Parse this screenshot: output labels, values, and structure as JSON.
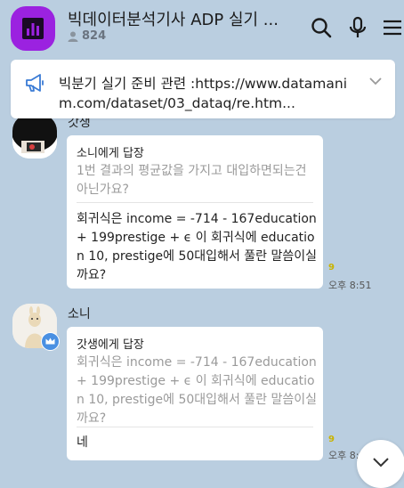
{
  "header": {
    "title": "빅데이터분석기사 ADP 실기 ...",
    "member_count": "824",
    "icons": [
      "bar-chart-icon",
      "person-icon",
      "search-icon",
      "microphone-icon",
      "menu-icon"
    ]
  },
  "notice": {
    "text": "빅분기 실기 준비 관련 :https://www.datamanim.com/dataset/03_dataq/re.htm...",
    "icons": [
      "megaphone-icon",
      "chevron-down-icon"
    ]
  },
  "messages": [
    {
      "sender": "갓생",
      "reply_to": "소니에게 답장",
      "quote": "1번 결과의 평균값을 가지고 대입하면되는건 아닌가요?",
      "text": "회귀식은 income = -714 - 167education + 199prestige + ϵ 이 회귀식에 education 10, prestige에 50대입해서 풀란 말씀이실까요?",
      "unread": "9",
      "time": "오후 8:51"
    },
    {
      "sender": "소니",
      "reply_to": "갓생에게 답장",
      "quote": "회귀식은 income = -714 - 167education + 199prestige + ϵ 이 회귀식에 education 10, prestige에 50대입해서 풀란 말씀이실까요?",
      "text": "네",
      "unread": "9",
      "time": "오후 8:5"
    }
  ],
  "colors": {
    "background": "#bacee0",
    "room_icon": "#9b22e0",
    "crown_badge": "#4a90e2",
    "unread": "#c9b300"
  },
  "scroll_button": {
    "icon": "chevron-down-icon"
  }
}
